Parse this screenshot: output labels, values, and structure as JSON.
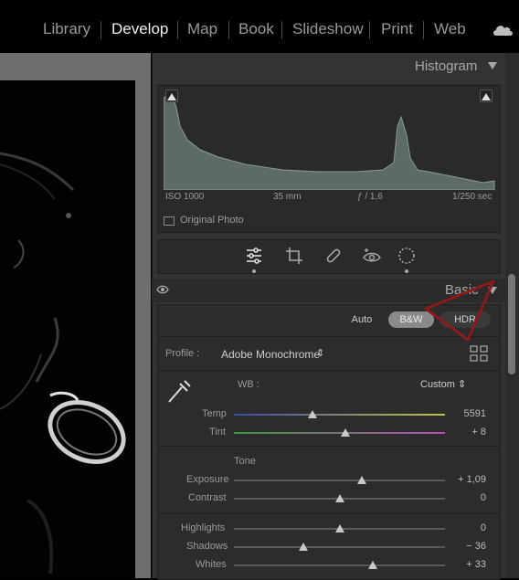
{
  "modules": [
    "Library",
    "Develop",
    "Map",
    "Book",
    "Slideshow",
    "Print",
    "Web"
  ],
  "active_module": "Develop",
  "histogram": {
    "title": "Histogram",
    "iso": "ISO 1000",
    "focal": "35 mm",
    "aperture": "ƒ / 1,6",
    "shutter": "1/250 sec",
    "original_photo": "Original Photo"
  },
  "tools": [
    "edit-sliders-icon",
    "crop-icon",
    "healing-icon",
    "red-eye-icon",
    "masking-icon"
  ],
  "basic": {
    "title": "Basic",
    "auto": "Auto",
    "bw": "B&W",
    "hdr": "HDR",
    "profile_label": "Profile :",
    "profile_value": "Adobe Monochrome",
    "wb_label": "WB :",
    "wb_value": "Custom",
    "tone_label": "Tone",
    "sliders": [
      {
        "label": "Temp",
        "value": "5591",
        "level": 0.37
      },
      {
        "label": "Tint",
        "value": "+ 8",
        "level": 0.53
      },
      {
        "label": "Exposure",
        "value": "+ 1,09",
        "level": 0.61
      },
      {
        "label": "Contrast",
        "value": "0",
        "level": 0.5
      },
      {
        "label": "Highlights",
        "value": "0",
        "level": 0.5
      },
      {
        "label": "Shadows",
        "value": "− 36",
        "level": 0.33
      },
      {
        "label": "Whites",
        "value": "+ 33",
        "level": 0.66
      }
    ]
  },
  "colors": {
    "panel": "#333333",
    "bw_active": "#8a8a8a",
    "annotation": "#8b1a1a"
  }
}
